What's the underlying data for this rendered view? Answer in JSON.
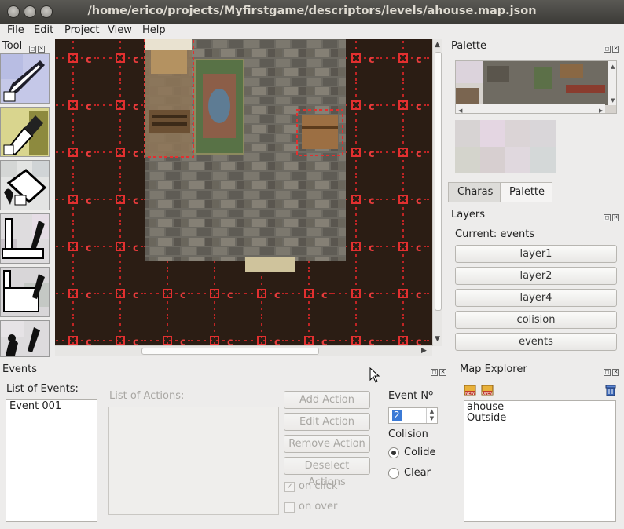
{
  "window": {
    "title": "/home/erico/projects/Myfirstgame/descriptors/levels/ahouse.map.json"
  },
  "menu": [
    "File",
    "Edit",
    "Project",
    "View",
    "Help"
  ],
  "tool_panel": {
    "title": "Tool",
    "tools": [
      "pencil-icon",
      "eyedropper-icon",
      "bucket-fill-icon",
      "line-tool-icon",
      "rectangle-tool-icon",
      "event-tool-icon"
    ]
  },
  "palette_panel": {
    "title": "Palette",
    "tabs": [
      "Charas",
      "Palette"
    ],
    "active_tab": "Palette"
  },
  "layers_panel": {
    "title": "Layers",
    "current_label": "Current: events",
    "layers": [
      "layer1",
      "layer2",
      "layer4",
      "colision",
      "events"
    ]
  },
  "events_panel": {
    "title": "Events",
    "list_label": "List of Events:",
    "events": [
      "Event 001"
    ],
    "actions_label": "List of Actions:",
    "buttons": {
      "add": "Add Action",
      "edit": "Edit Action",
      "remove": "Remove Action",
      "deselect": "Deselect Actions"
    },
    "on_click_label": "on click",
    "on_over_label": "on over",
    "event_number_label": "Event Nº",
    "event_number_value": "2",
    "colision_label": "Colision",
    "colide_label": "Colide",
    "clear_label": "Clear"
  },
  "map_explorer": {
    "title": "Map Explorer",
    "maps": [
      "ahouse",
      "Outside"
    ],
    "icons": [
      "new-map-icon",
      "open-map-icon",
      "delete-map-icon"
    ]
  }
}
